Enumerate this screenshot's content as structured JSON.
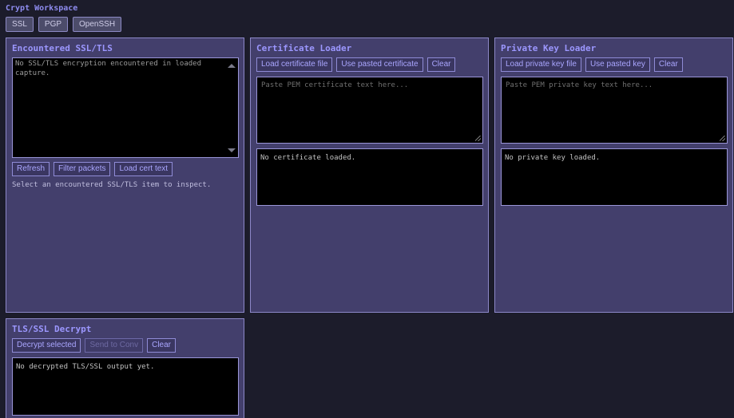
{
  "app": {
    "title": "Crypt Workspace"
  },
  "tabs": [
    {
      "label": "SSL"
    },
    {
      "label": "PGP"
    },
    {
      "label": "OpenSSH"
    }
  ],
  "encountered": {
    "title": "Encountered SSL/TLS",
    "list_text": "No SSL/TLS encryption encountered in loaded capture.",
    "buttons": {
      "refresh": "Refresh",
      "filter": "Filter packets",
      "load_cert_text": "Load cert text"
    },
    "hint": "Select an encountered SSL/TLS item to inspect."
  },
  "cert_loader": {
    "title": "Certificate Loader",
    "buttons": {
      "load_file": "Load certificate file",
      "use_pasted": "Use pasted certificate",
      "clear": "Clear"
    },
    "placeholder": "Paste PEM certificate text here...",
    "status": "No certificate loaded."
  },
  "key_loader": {
    "title": "Private Key Loader",
    "buttons": {
      "load_file": "Load private key file",
      "use_pasted": "Use pasted key",
      "clear": "Clear"
    },
    "placeholder": "Paste PEM private key text here...",
    "status": "No private key loaded."
  },
  "decrypt": {
    "title": "TLS/SSL Decrypt",
    "buttons": {
      "decrypt": "Decrypt selected",
      "send": "Send to Conv",
      "clear": "Clear"
    },
    "output": "No decrypted TLS/SSL output yet."
  },
  "colors": {
    "background": "#1c1c2b",
    "panel": "#433f6c",
    "accent": "#9c97ff",
    "button_text": "#aaa6ff"
  }
}
